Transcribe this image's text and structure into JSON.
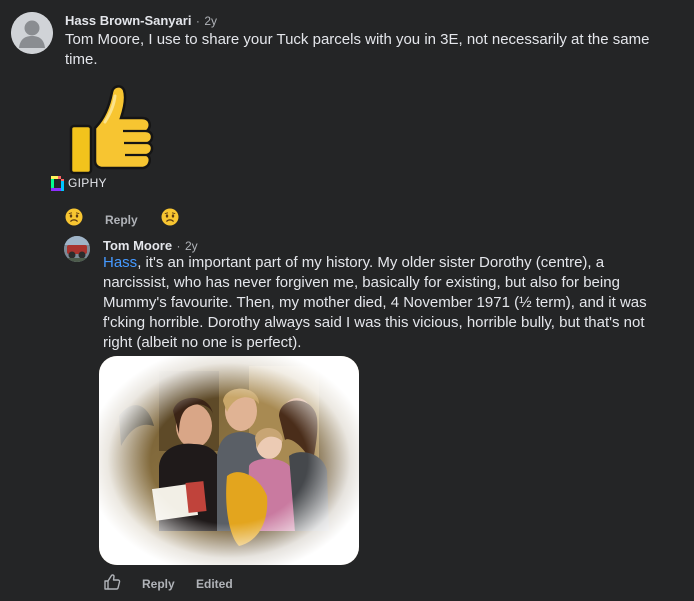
{
  "comment1": {
    "author": "Hass Brown-Sanyari",
    "time": "2y",
    "text_line1": "Tom Moore, I use to share your Tuck parcels with you in 3E, not necessarily at the same",
    "text_line2": "time.",
    "gif_source": "GIPHY",
    "actions": {
      "reply": "Reply"
    }
  },
  "comment2": {
    "author": "Tom Moore",
    "time": "2y",
    "mention": "Hass",
    "line1_rest": ", it's an important part of my history. My older sister Dorothy (centre), a",
    "line2": "narcissist, who has never forgiven me, basically for existing, but also for being",
    "line3": "Mummy's favourite. Then, my mother died, 4 November 1971 (½ term), and it was",
    "line4": "f'cking horrible. Dorothy always said I was this vicious, horrible bully, but that's not",
    "line5": "right (albeit no one is perfect).",
    "actions": {
      "reply": "Reply",
      "edited": "Edited"
    }
  },
  "separator": "·",
  "colors": {
    "background": "#242526",
    "text": "#e4e6eb",
    "secondary": "#b0b3b8",
    "mention": "#4599ff",
    "emoji": "#f7c531"
  },
  "icons": {
    "avatar_default": "default-avatar-icon",
    "gif": "thumbs-up-gif",
    "giphy_logo": "giphy-logo-icon",
    "reaction_sad": "sad-face-icon",
    "like": "thumbs-up-outline-icon"
  }
}
